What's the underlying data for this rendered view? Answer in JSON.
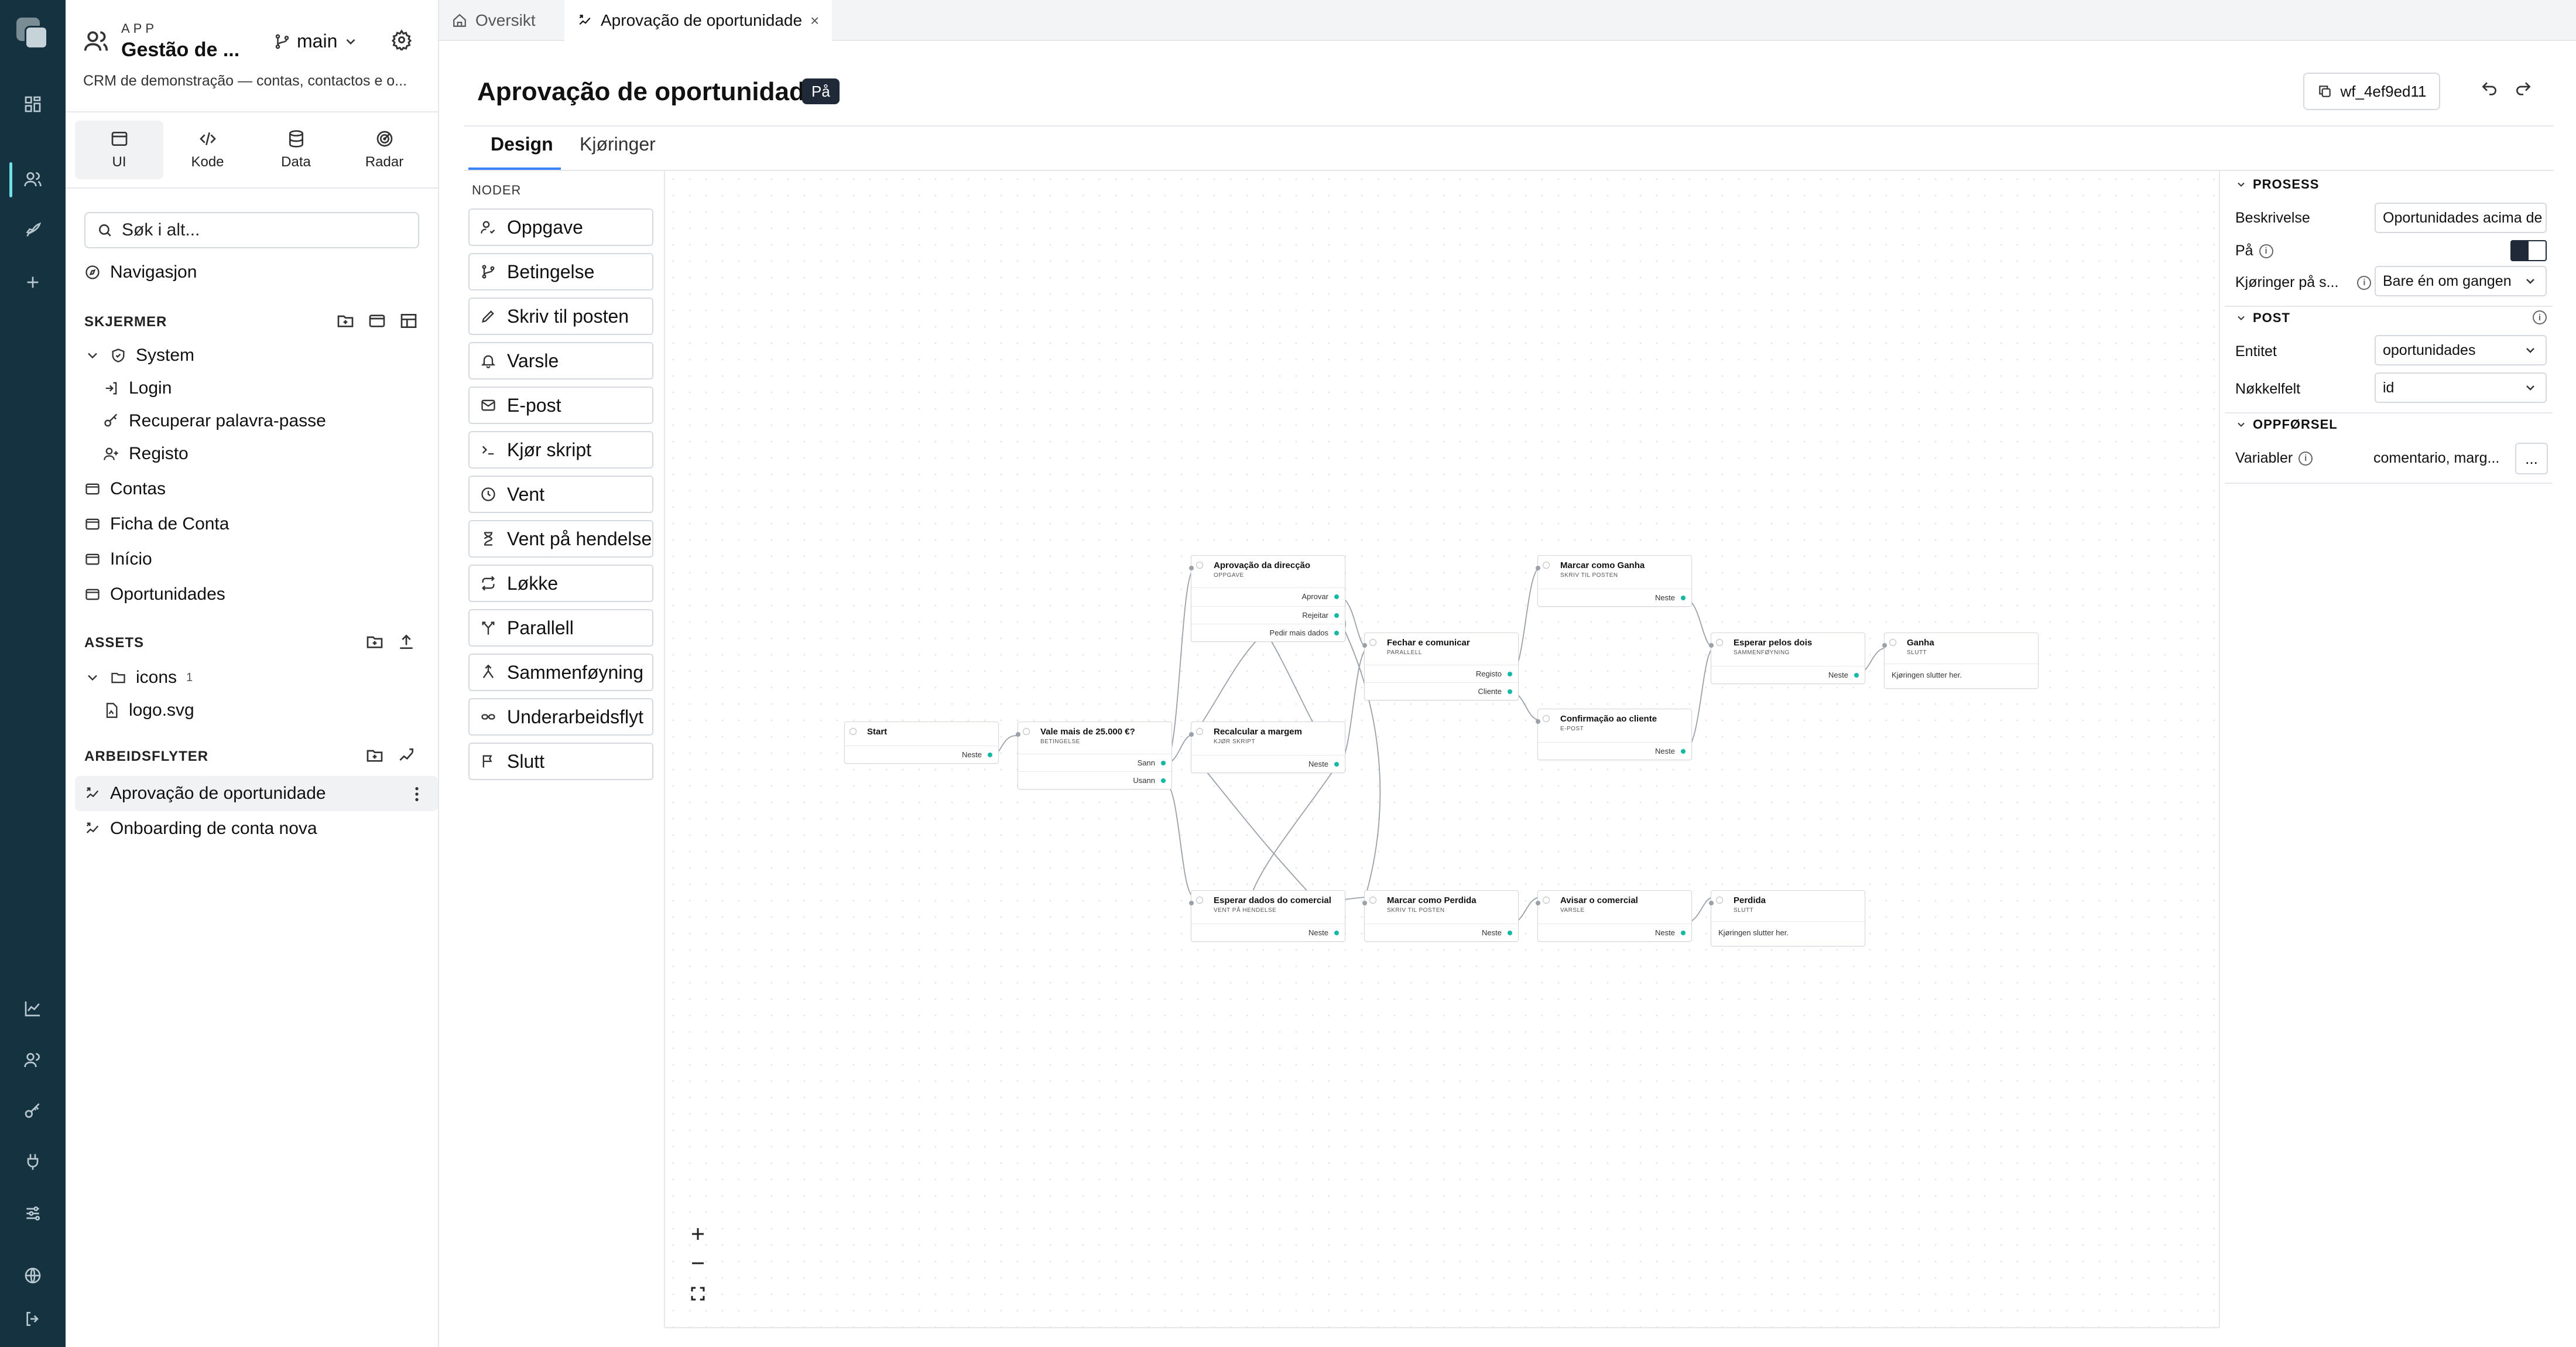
{
  "app": {
    "kicker": "APP",
    "title": "Gestão de ...",
    "branch": "main",
    "description": "CRM de demonstração — contas, contactos e o..."
  },
  "modes": [
    {
      "label": "UI",
      "icon": "ui-icon",
      "active": true
    },
    {
      "label": "Kode",
      "icon": "code-icon"
    },
    {
      "label": "Data",
      "icon": "database-icon"
    },
    {
      "label": "Radar",
      "icon": "radar-icon"
    }
  ],
  "search": {
    "placeholder": "Søk i alt..."
  },
  "navigation_label": "Navigasjon",
  "screens": {
    "heading": "SKJERMER",
    "group": "System",
    "group_items": [
      "Login",
      "Recuperar palavra-passe",
      "Registo"
    ],
    "items": [
      "Contas",
      "Ficha de Conta",
      "Início",
      "Oportunidades"
    ]
  },
  "assets": {
    "heading": "ASSETS",
    "folder": "icons",
    "folder_count": "1",
    "file": "logo.svg"
  },
  "workflows": {
    "heading": "ARBEIDSFLYTER",
    "items": [
      "Aprovação de oportunidade",
      "Onboarding de conta nova"
    ]
  },
  "tabs": [
    {
      "label": "Oversikt",
      "icon": "home-icon"
    },
    {
      "label": "Aprovação de oportunidade",
      "icon": "workflow-icon",
      "close": "×"
    }
  ],
  "page": {
    "title": "Aprovação de oportunidade",
    "status": "På",
    "workflow_id": "wf_4ef9ed11",
    "subtabs": [
      "Design",
      "Kjøringer"
    ]
  },
  "palette": {
    "heading": "NODER",
    "items": [
      {
        "label": "Oppgave",
        "icon": "user-task-icon"
      },
      {
        "label": "Betingelse",
        "icon": "branch-icon"
      },
      {
        "label": "Skriv til posten",
        "icon": "pencil-icon"
      },
      {
        "label": "Varsle",
        "icon": "bell-icon"
      },
      {
        "label": "E-post",
        "icon": "mail-icon"
      },
      {
        "label": "Kjør skript",
        "icon": "terminal-icon"
      },
      {
        "label": "Vent",
        "icon": "clock-icon"
      },
      {
        "label": "Vent på hendelse",
        "icon": "hourglass-icon"
      },
      {
        "label": "Løkke",
        "icon": "loop-icon"
      },
      {
        "label": "Parallell",
        "icon": "split-icon"
      },
      {
        "label": "Sammenføyning",
        "icon": "merge-icon"
      },
      {
        "label": "Underarbeidsflyt",
        "icon": "subflow-icon"
      },
      {
        "label": "Slutt",
        "icon": "flag-icon"
      }
    ]
  },
  "flow": {
    "start": {
      "title": "Start",
      "out": "Neste"
    },
    "cond": {
      "title": "Vale mais de 25.000 €?",
      "kind": "BETINGELSE",
      "outs": [
        "Sann",
        "Usann"
      ]
    },
    "approval": {
      "title": "Aprovação da direcção",
      "kind": "OPPGAVE",
      "outs": [
        "Aprovar",
        "Rejeitar",
        "Pedir mais dados"
      ]
    },
    "recalc": {
      "title": "Recalcular a margem",
      "kind": "KJØR SKRIPT",
      "out": "Neste"
    },
    "waitdata": {
      "title": "Esperar dados do comercial",
      "kind": "VENT PÅ HENDELSE",
      "out": "Neste"
    },
    "closecomm": {
      "title": "Fechar e comunicar",
      "kind": "PARALLELL",
      "outs": [
        "Registo",
        "Cliente"
      ]
    },
    "markwon": {
      "title": "Marcar como Ganha",
      "kind": "SKRIV TIL POSTEN",
      "out": "Neste"
    },
    "confirm": {
      "title": "Confirmação ao cliente",
      "kind": "E-POST",
      "out": "Neste"
    },
    "waitboth": {
      "title": "Esperar pelos dois",
      "kind": "SAMMENFØYNING",
      "out": "Neste"
    },
    "won": {
      "title": "Ganha",
      "kind": "SLUTT",
      "note": "Kjøringen slutter her."
    },
    "marklost": {
      "title": "Marcar como Perdida",
      "kind": "SKRIV TIL POSTEN",
      "out": "Neste"
    },
    "notify": {
      "title": "Avisar o comercial",
      "kind": "VARSLE",
      "out": "Neste"
    },
    "lost": {
      "title": "Perdida",
      "kind": "SLUTT",
      "note": "Kjøringen slutter her."
    }
  },
  "panel": {
    "process": {
      "heading": "PROSESS",
      "description_label": "Beskrivelse",
      "description_value": "Oportunidades acima de",
      "enabled_label": "På",
      "enabled": true,
      "runs_label": "Kjøringer på s...",
      "runs_value": "Bare én om gangen"
    },
    "post": {
      "heading": "POST",
      "entity_label": "Entitet",
      "entity_value": "oportunidades",
      "key_label": "Nøkkelfelt",
      "key_value": "id"
    },
    "behaviour": {
      "heading": "OPPFØRSEL",
      "variables_label": "Variabler",
      "variables_value": "comentario, marg...",
      "more": "..."
    }
  },
  "colors": {
    "rail": "#153241",
    "accent": "#3b82f6",
    "port": "#14b8a6"
  }
}
